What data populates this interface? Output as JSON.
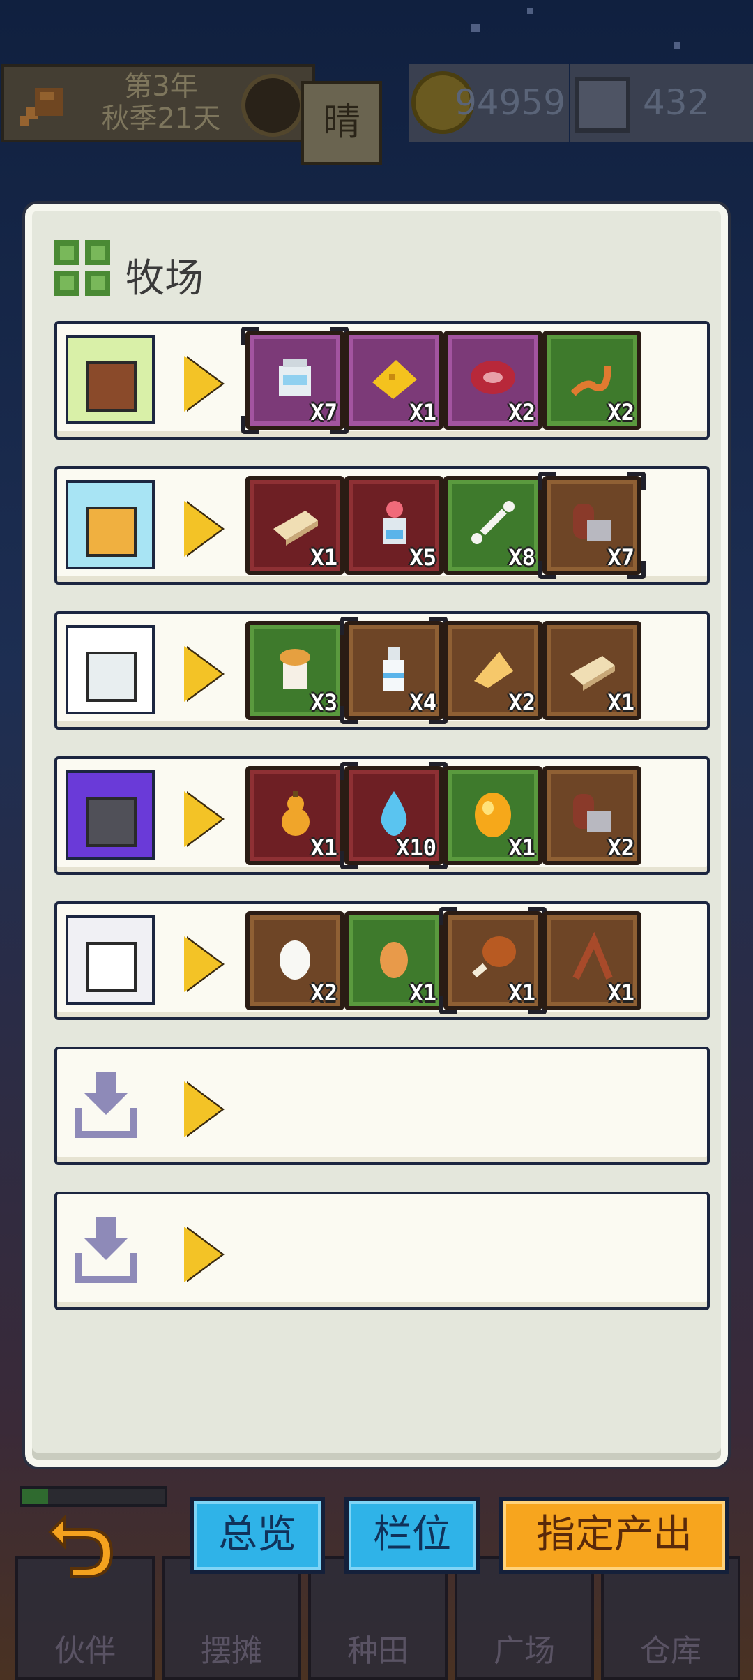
{
  "hud": {
    "year": "第3年",
    "season_day": "秋季21天",
    "weather": "晴",
    "coins": "94959",
    "gems": "432"
  },
  "panel": {
    "title": "牧场",
    "rows": [
      {
        "animal": "boar",
        "portrait_bg": "#d9f0a8",
        "items": [
          {
            "icon": "milk-jar",
            "qty": "X7",
            "rarity": "purple",
            "selected": true
          },
          {
            "icon": "cheese",
            "qty": "X1",
            "rarity": "purple",
            "selected": false
          },
          {
            "icon": "raw-meat",
            "qty": "X2",
            "rarity": "purple",
            "selected": false
          },
          {
            "icon": "tail",
            "qty": "X2",
            "rarity": "green",
            "selected": false
          }
        ]
      },
      {
        "animal": "fox",
        "portrait_bg": "#a8e4f4",
        "items": [
          {
            "icon": "butter",
            "qty": "X1",
            "rarity": "red",
            "selected": false
          },
          {
            "icon": "potion-bottle",
            "qty": "X5",
            "rarity": "red",
            "selected": false
          },
          {
            "icon": "bone",
            "qty": "X8",
            "rarity": "green",
            "selected": false
          },
          {
            "icon": "sausage",
            "qty": "X7",
            "rarity": "brown",
            "selected": true
          }
        ]
      },
      {
        "animal": "cow",
        "portrait_bg": "#ffffff",
        "items": [
          {
            "icon": "yogurt",
            "qty": "X3",
            "rarity": "green",
            "selected": false
          },
          {
            "icon": "milk-bottle",
            "qty": "X4",
            "rarity": "brown",
            "selected": true
          },
          {
            "icon": "cheese-wedge",
            "qty": "X2",
            "rarity": "brown",
            "selected": false
          },
          {
            "icon": "butter",
            "qty": "X1",
            "rarity": "brown",
            "selected": false
          }
        ]
      },
      {
        "animal": "wolf",
        "portrait_bg": "#6a3ad8",
        "items": [
          {
            "icon": "gourd",
            "qty": "X1",
            "rarity": "red",
            "selected": false
          },
          {
            "icon": "water-drop",
            "qty": "X10",
            "rarity": "red",
            "selected": true
          },
          {
            "icon": "golden-egg",
            "qty": "X1",
            "rarity": "green",
            "selected": false
          },
          {
            "icon": "sausage",
            "qty": "X2",
            "rarity": "brown",
            "selected": false
          }
        ]
      },
      {
        "animal": "chicken",
        "portrait_bg": "#f0f0f4",
        "items": [
          {
            "icon": "egg",
            "qty": "X2",
            "rarity": "brown",
            "selected": false
          },
          {
            "icon": "brown-egg",
            "qty": "X1",
            "rarity": "green",
            "selected": false
          },
          {
            "icon": "drumstick",
            "qty": "X1",
            "rarity": "brown",
            "selected": true
          },
          {
            "icon": "chicken-bones",
            "qty": "X1",
            "rarity": "brown",
            "selected": false
          }
        ]
      }
    ],
    "empty_slots": 2
  },
  "buttons": {
    "overview": "总览",
    "pens": "栏位",
    "assign_output": "指定产出"
  },
  "bottom_nav": [
    "伙伴",
    "摆摊",
    "种田",
    "广场",
    "仓库"
  ],
  "progress_fill": 0.18
}
